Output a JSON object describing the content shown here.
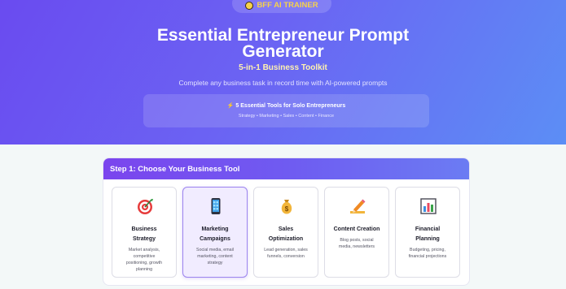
{
  "hero": {
    "badge_label": "BFF AI TRAINER",
    "title_line1": "Essential Entrepreneur Prompt",
    "title_line2": "Generator",
    "subtitle": "5-in-1 Business Toolkit",
    "tagline": "Complete any business task in record time with AI-powered prompts",
    "tools_title": "5 Essential Tools for Solo Entrepreneurs",
    "tools_list": "Strategy • Marketing • Sales • Content • Finance",
    "bolt_glyph": "⚡"
  },
  "step": {
    "header": "Step 1: Choose Your Business Tool",
    "cards": [
      {
        "title_line1": "Business",
        "title_line2": "Strategy",
        "desc_lines": [
          "Market analysis,",
          "competitive",
          "positioning, growth",
          "planning"
        ],
        "icon": "target-icon",
        "selected": false
      },
      {
        "title_line1": "Marketing",
        "title_line2": "Campaigns",
        "desc_lines": [
          "Social media, email",
          "marketing, content",
          "strategy"
        ],
        "icon": "phone-icon",
        "selected": true
      },
      {
        "title_line1": "Sales",
        "title_line2": "Optimization",
        "desc_lines": [
          "Lead generation, sales",
          "funnels, conversion"
        ],
        "icon": "money-bag-icon",
        "selected": false
      },
      {
        "title_line1": "Content Creation",
        "title_line2": "",
        "desc_lines": [
          "Blog posts, social",
          "media, newsletters"
        ],
        "icon": "pencil-icon",
        "selected": false
      },
      {
        "title_line1": "Financial",
        "title_line2": "Planning",
        "desc_lines": [
          "Budgeting, pricing,",
          "financial projections"
        ],
        "icon": "bar-chart-icon",
        "selected": false
      }
    ]
  },
  "colors": {
    "hero_gradient_start": "#6a4bf0",
    "hero_gradient_end": "#5c8ef5",
    "accent_yellow": "#f7d24a",
    "selected_border": "#9c84ee"
  }
}
